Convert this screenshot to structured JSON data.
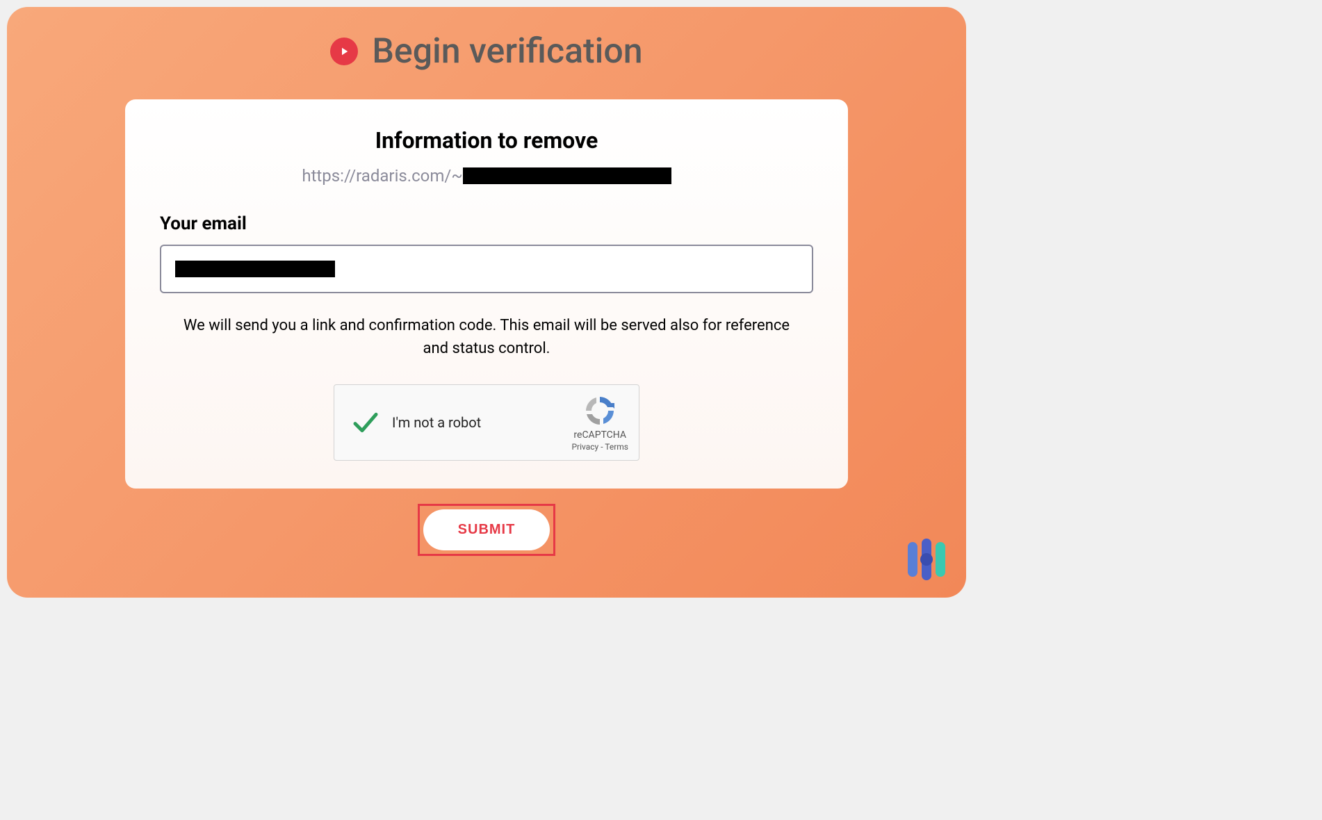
{
  "header": {
    "title": "Begin verification"
  },
  "form": {
    "section_title": "Information to remove",
    "url_prefix": "https://radaris.com/~",
    "email_label": "Your email",
    "helper_text": "We will send you a link and confirmation code. This email will be served also for reference and status control."
  },
  "recaptcha": {
    "label": "I'm not a robot",
    "brand": "reCAPTCHA",
    "privacy": "Privacy",
    "separator": " - ",
    "terms": "Terms"
  },
  "submit": {
    "label": "SUBMIT"
  }
}
